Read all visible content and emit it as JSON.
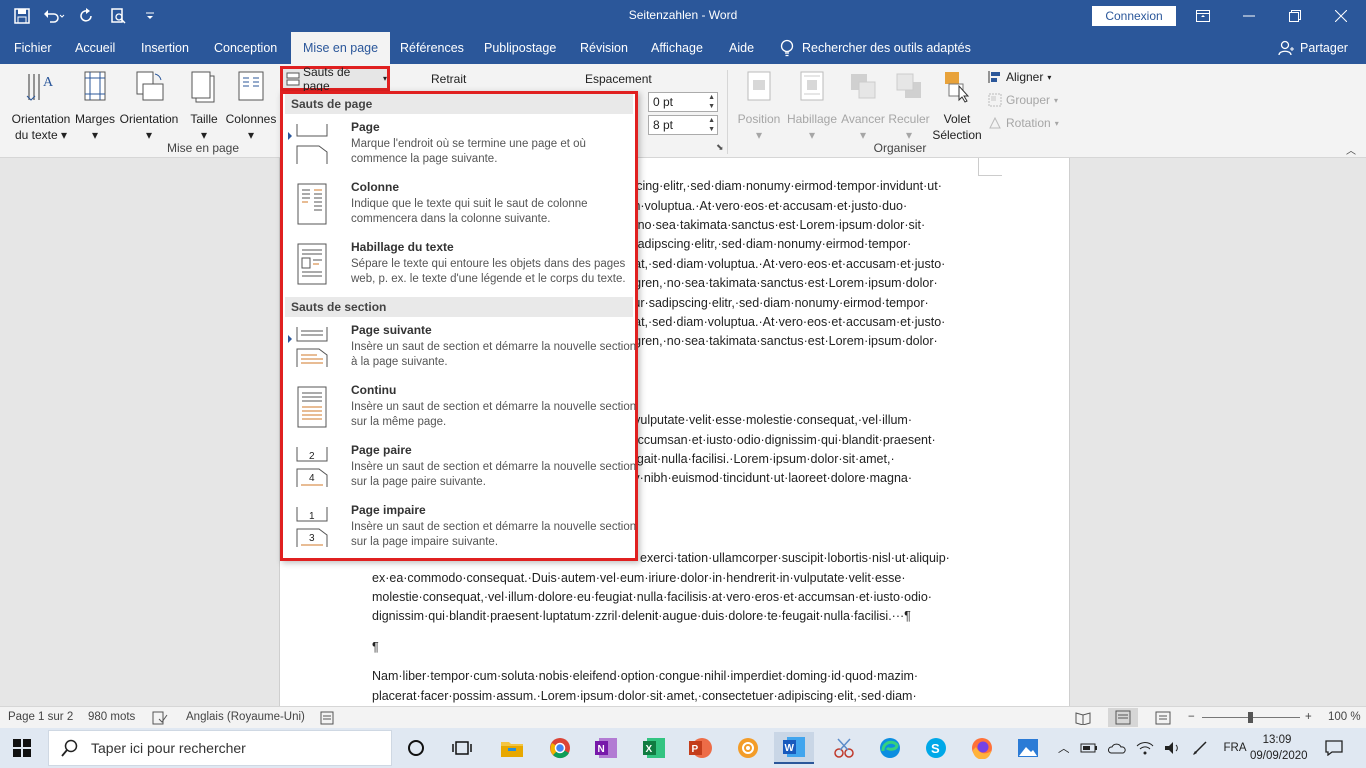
{
  "window": {
    "title": "Seitenzahlen - Word",
    "connexion_label": "Connexion"
  },
  "tabs": [
    "Fichier",
    "Accueil",
    "Insertion",
    "Conception",
    "Mise en page",
    "Références",
    "Publipostage",
    "Révision",
    "Affichage",
    "Aide"
  ],
  "search_tools_label": "Rechercher des outils adaptés",
  "share_label": "Partager",
  "ribbon": {
    "orientation_texte": [
      "Orientation",
      "du texte"
    ],
    "marges": "Marges",
    "orientation": "Orientation",
    "taille": "Taille",
    "colonnes": "Colonnes",
    "group_mise_en_page": "Mise en page",
    "sauts_de_page": "Sauts de page",
    "retrait": "Retrait",
    "espacement": "Espacement",
    "espacement_avant": "0 pt",
    "espacement_apres": "8 pt",
    "position": "Position",
    "habillage": "Habillage",
    "avancer": "Avancer",
    "reculer": "Reculer",
    "volet_selection": [
      "Volet",
      "Sélection"
    ],
    "aligner": "Aligner",
    "grouper": "Grouper",
    "rotation": "Rotation",
    "group_organiser": "Organiser"
  },
  "dropdown": {
    "header_page": "Sauts de page",
    "header_section": "Sauts de section",
    "items": [
      {
        "title": "Page",
        "desc": "Marque l'endroit où se termine une page et où commence la page suivante."
      },
      {
        "title": "Colonne",
        "desc": "Indique que le texte qui suit le saut de colonne commencera dans la colonne suivante."
      },
      {
        "title": "Habillage du texte",
        "desc": "Sépare le texte qui entoure les objets dans des pages web, p. ex. le texte d'une légende et le corps du texte."
      },
      {
        "title": "Page suivante",
        "desc": "Insère un saut de section et démarre la nouvelle section à la page suivante."
      },
      {
        "title": "Continu",
        "desc": "Insère un saut de section et démarre la nouvelle section sur la même page."
      },
      {
        "title": "Page paire",
        "desc": "Insère un saut de section et démarre la nouvelle section sur la page paire suivante."
      },
      {
        "title": "Page impaire",
        "desc": "Insère un saut de section et démarre la nouvelle section sur la page impaire suivante."
      }
    ]
  },
  "document": {
    "lines_right": [
      "pscing·elitr,·sed·diam·nonumy·eirmod·tempor·invidunt·ut·",
      "am·voluptua.·At·vero·eos·et·accusam·et·justo·duo·",
      "n,·no·sea·takimata·sanctus·est·Lorem·ipsum·dolor·sit·",
      "r·sadipscing·elitr,·sed·diam·nonumy·eirmod·tempor·",
      "erat,·sed·diam·voluptua.·At·vero·eos·et·accusam·et·justo·",
      "ergren,·no·sea·takimata·sanctus·est·Lorem·ipsum·dolor·",
      "etur·sadipscing·elitr,·sed·diam·nonumy·eirmod·tempor·",
      "erat,·sed·diam·voluptua.·At·vero·eos·et·accusam·et·justo·",
      "ergren,·no·sea·takimata·sanctus·est·Lorem·ipsum·dolor·",
      "n·vulputate·velit·esse·molestie·consequat,·vel·illum·",
      "t·accumsan·et·iusto·odio·dignissim·qui·blandit·praesent·",
      "eugait·nulla·facilisi.·Lorem·ipsum·dolor·sit·amet,·",
      "my·nibh·euismod·tincidunt·ut·laoreet·dolore·magna·",
      "exerci·tation·ullamcorper·suscipit·lobortis·nisl·ut·aliquip·"
    ],
    "lines_full": [
      "ex·ea·commodo·consequat.·Duis·autem·vel·eum·iriure·dolor·in·hendrerit·in·vulputate·velit·esse·",
      "molestie·consequat,·vel·illum·dolore·eu·feugiat·nulla·facilisis·at·vero·eros·et·accumsan·et·iusto·odio·",
      "dignissim·qui·blandit·praesent·luptatum·zzril·delenit·augue·duis·dolore·te·feugait·nulla·facilisi.···¶",
      "¶",
      "Nam·liber·tempor·cum·soluta·nobis·eleifend·option·congue·nihil·imperdiet·doming·id·quod·mazim·",
      "placerat·facer·possim·assum.·Lorem·ipsum·dolor·sit·amet,·consectetuer·adipiscing·elit,·sed·diam·"
    ]
  },
  "status": {
    "page": "Page 1 sur 2",
    "words": "980 mots",
    "language": "Anglais (Royaume-Uni)",
    "zoom": "100 %"
  },
  "taskbar": {
    "search_placeholder": "Taper ici pour rechercher",
    "lang": "FRA",
    "time": "13:09",
    "date": "09/09/2020"
  },
  "colors": {
    "accent": "#2b579a",
    "highlight_red": "#e02020"
  }
}
